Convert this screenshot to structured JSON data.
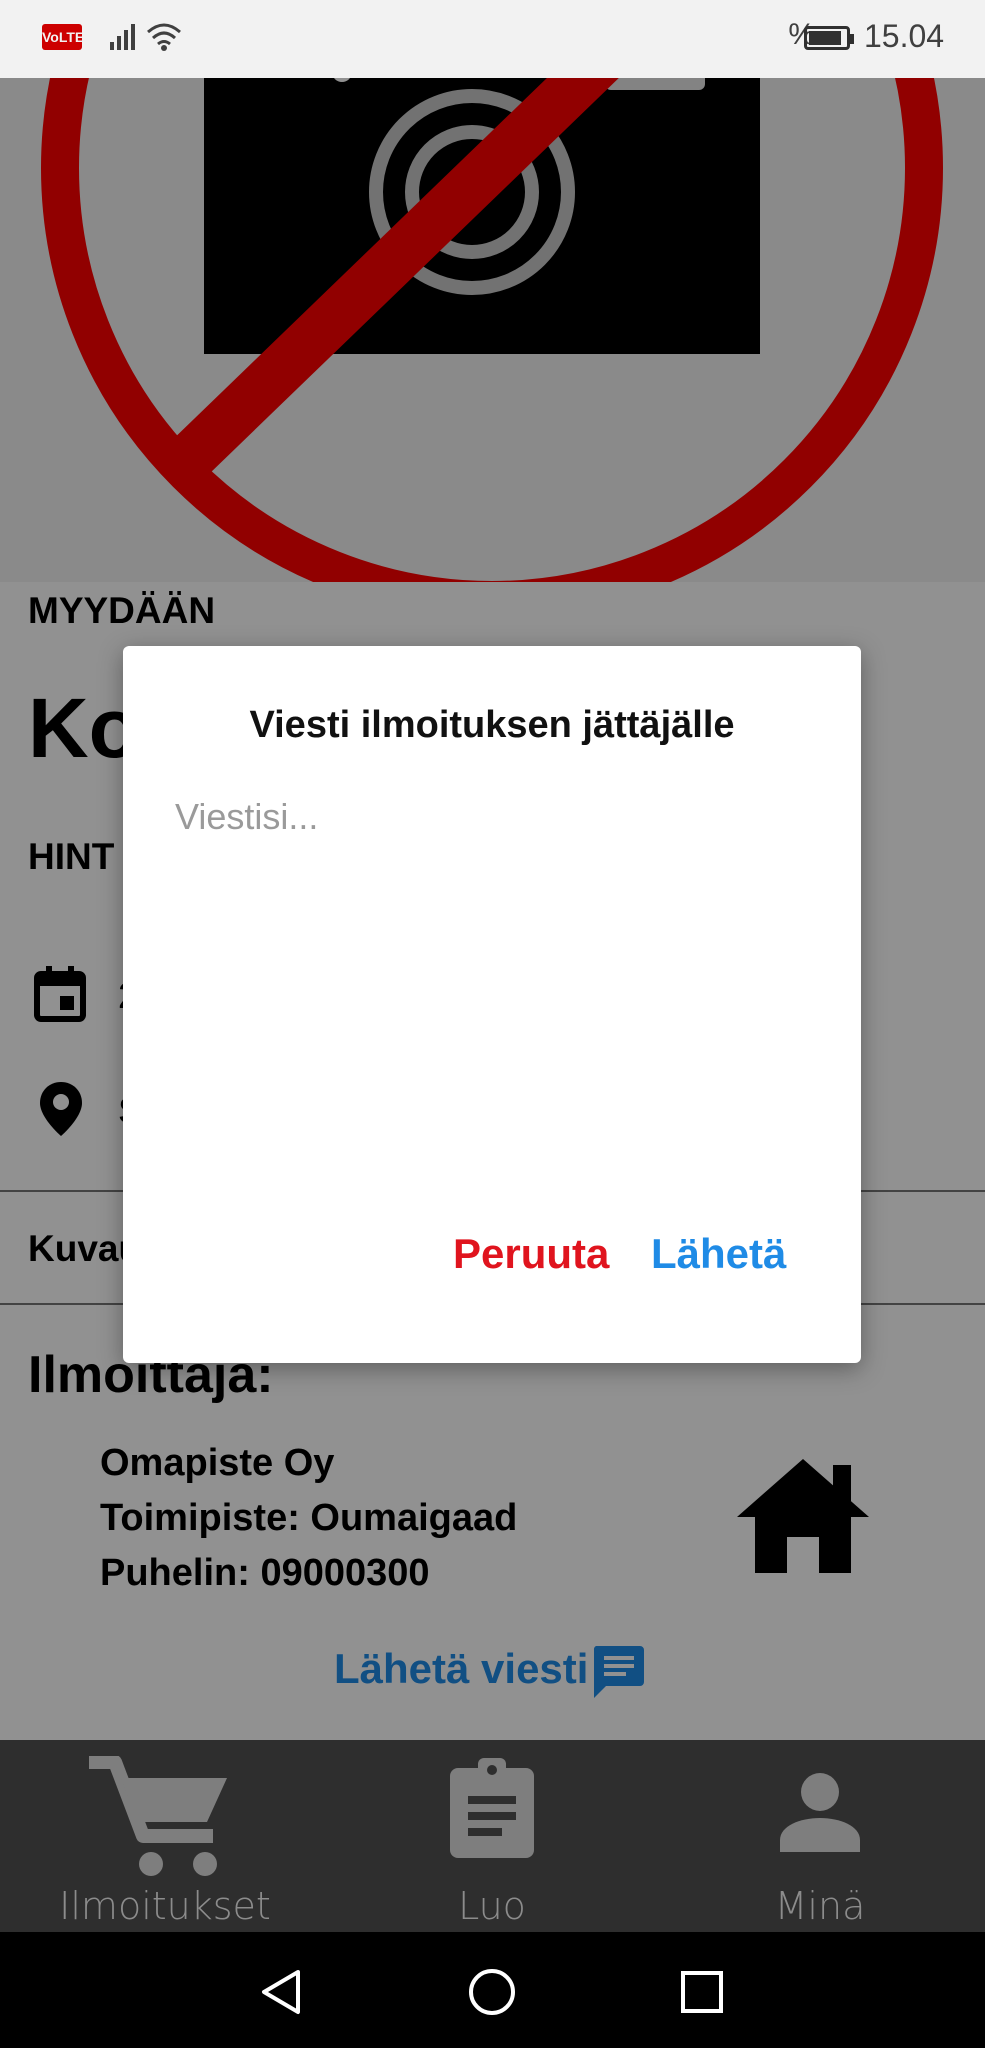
{
  "status_bar": {
    "network_badge": "VoLTE",
    "battery_text": "%",
    "time": "15.04"
  },
  "listing": {
    "type_label": "MYYDÄÄN",
    "title": "Ko",
    "price_label": "HINT",
    "date_value": "2",
    "location_value": "S",
    "description_label": "Kuvau"
  },
  "advertiser": {
    "heading": "Ilmoittaja:",
    "company": "Omapiste Oy",
    "office": "Toimipiste: Oumaigaad",
    "phone": "Puhelin: 09000300",
    "send_message": "Lähetä viesti"
  },
  "dialog": {
    "title": "Viesti ilmoituksen jättäjälle",
    "placeholder": "Viestisi...",
    "cancel": "Peruuta",
    "send": "Lähetä"
  },
  "bottom_nav": {
    "items": [
      {
        "label": "Ilmoitukset",
        "icon": "cart-icon"
      },
      {
        "label": "Luo",
        "icon": "clipboard-icon"
      },
      {
        "label": "Minä",
        "icon": "person-icon"
      }
    ]
  },
  "colors": {
    "accent_blue": "#1f8be6",
    "cancel_red": "#e0141e",
    "no_camera_red": "#ff0000"
  }
}
